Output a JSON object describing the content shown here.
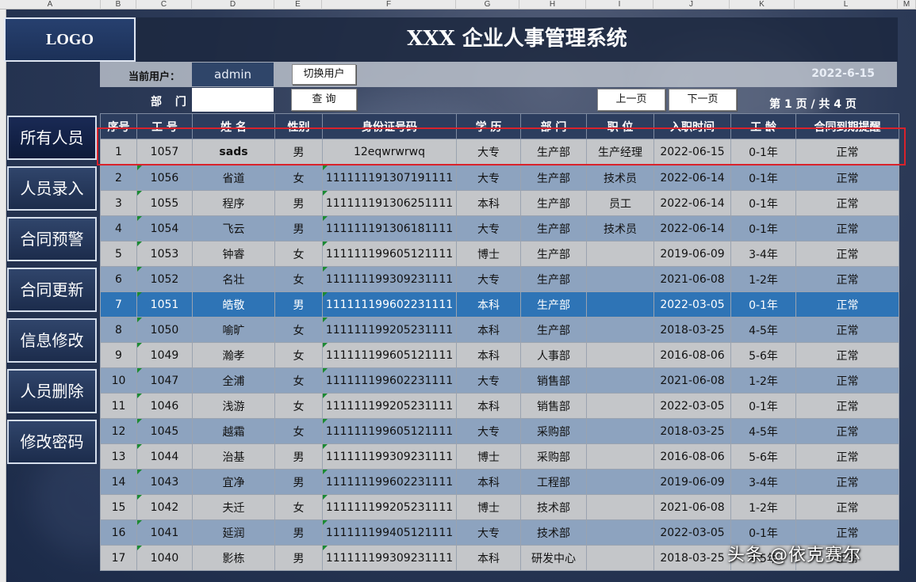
{
  "excel": {
    "columns": [
      "A",
      "B",
      "C",
      "D",
      "E",
      "F",
      "G",
      "H",
      "I",
      "J",
      "K",
      "L",
      "M"
    ]
  },
  "logo": "LOGO",
  "title": "XXX 企业人事管理系统",
  "user": {
    "label": "当前用户：",
    "value": "admin",
    "switch_button": "切换用户",
    "date": "2022-6-15"
  },
  "query": {
    "dept_label": "部 门",
    "dept_value": "",
    "query_button": "查 询",
    "prev_button": "上一页",
    "next_button": "下一页",
    "page_info": "第 1 页 / 共 4 页"
  },
  "sidebar": {
    "items": [
      {
        "label": "所有人员",
        "active": true
      },
      {
        "label": "人员录入"
      },
      {
        "label": "合同预警"
      },
      {
        "label": "合同更新"
      },
      {
        "label": "信息修改"
      },
      {
        "label": "人员删除"
      },
      {
        "label": "修改密码"
      }
    ]
  },
  "table": {
    "headers": [
      "序号",
      "工 号",
      "姓 名",
      "性别",
      "身份证号码",
      "学 历",
      "部 门",
      "职 位",
      "入职时间",
      "工 龄",
      "合同到期提醒"
    ],
    "rows": [
      [
        "1",
        "1057",
        "sads",
        "男",
        "12eqwrwrwq",
        "大专",
        "生产部",
        "生产经理",
        "2022-06-15",
        "0-1年",
        "正常"
      ],
      [
        "2",
        "1056",
        "省道",
        "女",
        "111111191307191111",
        "大专",
        "生产部",
        "技术员",
        "2022-06-14",
        "0-1年",
        "正常"
      ],
      [
        "3",
        "1055",
        "程序",
        "男",
        "111111191306251111",
        "本科",
        "生产部",
        "员工",
        "2022-06-14",
        "0-1年",
        "正常"
      ],
      [
        "4",
        "1054",
        "飞云",
        "男",
        "111111191306181111",
        "大专",
        "生产部",
        "技术员",
        "2022-06-14",
        "0-1年",
        "正常"
      ],
      [
        "5",
        "1053",
        "钟睿",
        "女",
        "111111199605121111",
        "博士",
        "生产部",
        "",
        "2019-06-09",
        "3-4年",
        "正常"
      ],
      [
        "6",
        "1052",
        "名壮",
        "女",
        "111111199309231111",
        "大专",
        "生产部",
        "",
        "2021-06-08",
        "1-2年",
        "正常"
      ],
      [
        "7",
        "1051",
        "皓敬",
        "男",
        "111111199602231111",
        "本科",
        "生产部",
        "",
        "2022-03-05",
        "0-1年",
        "正常"
      ],
      [
        "8",
        "1050",
        "喻旷",
        "女",
        "111111199205231111",
        "本科",
        "生产部",
        "",
        "2018-03-25",
        "4-5年",
        "正常"
      ],
      [
        "9",
        "1049",
        "瀚孝",
        "女",
        "111111199605121111",
        "本科",
        "人事部",
        "",
        "2016-08-06",
        "5-6年",
        "正常"
      ],
      [
        "10",
        "1047",
        "全浦",
        "女",
        "111111199602231111",
        "大专",
        "销售部",
        "",
        "2021-06-08",
        "1-2年",
        "正常"
      ],
      [
        "11",
        "1046",
        "浅游",
        "女",
        "111111199205231111",
        "本科",
        "销售部",
        "",
        "2022-03-05",
        "0-1年",
        "正常"
      ],
      [
        "12",
        "1045",
        "越霜",
        "女",
        "111111199605121111",
        "大专",
        "采购部",
        "",
        "2018-03-25",
        "4-5年",
        "正常"
      ],
      [
        "13",
        "1044",
        "治基",
        "男",
        "111111199309231111",
        "博士",
        "采购部",
        "",
        "2016-08-06",
        "5-6年",
        "正常"
      ],
      [
        "14",
        "1043",
        "宜净",
        "男",
        "111111199602231111",
        "本科",
        "工程部",
        "",
        "2019-06-09",
        "3-4年",
        "正常"
      ],
      [
        "15",
        "1042",
        "夫迁",
        "女",
        "111111199205231111",
        "博士",
        "技术部",
        "",
        "2021-06-08",
        "1-2年",
        "正常"
      ],
      [
        "16",
        "1041",
        "延润",
        "男",
        "111111199405121111",
        "大专",
        "技术部",
        "",
        "2022-03-05",
        "0-1年",
        "正常"
      ],
      [
        "17",
        "1040",
        "影栋",
        "男",
        "111111199309231111",
        "本科",
        "研发中心",
        "",
        "2018-03-25",
        "4-5年",
        "正常"
      ]
    ]
  },
  "watermark": "头条 @依克赛尔",
  "colors": {
    "header_bg": "#2c3d5e",
    "row_odd": "#c4c6c9",
    "row_even": "#8da3bf",
    "row_selected": "#2e74b6",
    "highlight_border": "#d9222b"
  }
}
